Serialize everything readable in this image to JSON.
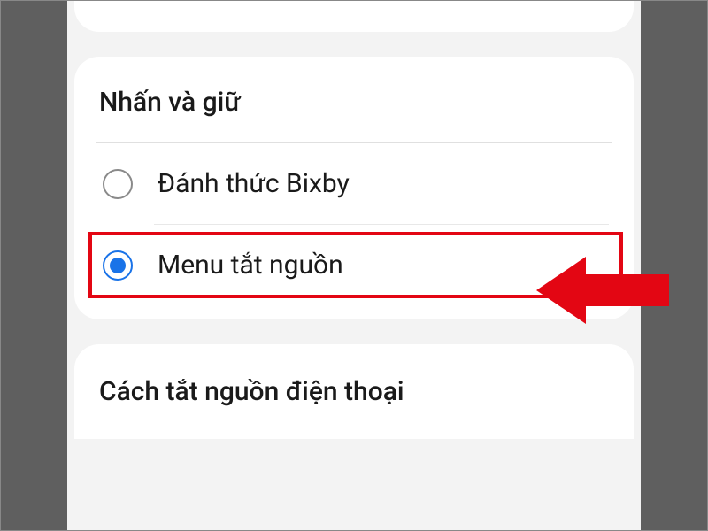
{
  "section": {
    "title": "Nhấn và giữ",
    "options": [
      {
        "label": "Đánh thức Bixby",
        "selected": false
      },
      {
        "label": "Menu tắt nguồn",
        "selected": true
      }
    ]
  },
  "next_section": {
    "title": "Cách tắt nguồn điện thoại"
  },
  "annotation": {
    "highlight_color": "#e30613",
    "arrow_color": "#e30613"
  }
}
